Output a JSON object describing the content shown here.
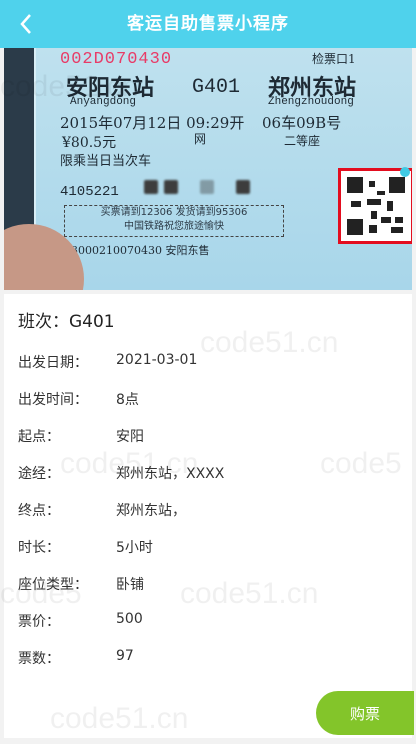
{
  "header": {
    "title": "客运自助售票小程序",
    "back_icon": "chevron-left-icon"
  },
  "ticket_image": {
    "serial_top": "002D070430",
    "gate": "检票口1",
    "from_station": "安阳东站",
    "from_pinyin": "Anyangdong",
    "train": "G401",
    "to_station": "郑州东站",
    "to_pinyin": "Zhengzhoudong",
    "date_time": "2015年07月12日 09:29开",
    "seat": "06车09B号",
    "price": "¥80.5元",
    "ticket_type": "网",
    "seat_class": "二等座",
    "limit": "限乘当日当次车",
    "id_number": "4105221",
    "notice_line1": "买票请到12306 发货请到95306",
    "notice_line2": "中国铁路祝您旅途愉快",
    "bottom": "13000210070430 安阳东售"
  },
  "details": {
    "train_line": "班次：G401",
    "rows": [
      {
        "label": "出发日期：",
        "value": "2021-03-01"
      },
      {
        "label": "出发时间：",
        "value": "8点"
      },
      {
        "label": "起点：",
        "value": "安阳"
      },
      {
        "label": "途经：",
        "value": "郑州东站，XXXX"
      },
      {
        "label": "终点：",
        "value": "郑州东站，"
      },
      {
        "label": "时长：",
        "value": "5小时"
      },
      {
        "label": "座位类型：",
        "value": "卧铺"
      },
      {
        "label": "票价：",
        "value": "500"
      },
      {
        "label": "票数：",
        "value": "97"
      }
    ]
  },
  "buy_button": {
    "label": "购票"
  },
  "watermark": {
    "text1": "code51.cn",
    "text2": "code5"
  },
  "colors": {
    "header": "#4fd2ec",
    "buy": "#83c52a",
    "qr_border": "#e30d1f",
    "serial": "#e83b67"
  }
}
